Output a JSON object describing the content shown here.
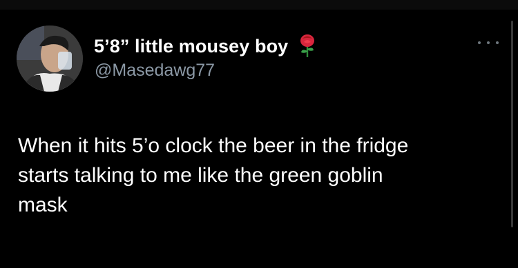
{
  "tweet": {
    "display_name": "5’8” little mousey boy",
    "handle": "@Masedawg77",
    "emoji_icon": "rose-icon",
    "more_icon": "more-icon",
    "text": "When it hits 5’o clock the beer in the fridge\nstarts talking to me like the green goblin\nmask"
  },
  "colors": {
    "background": "#000000",
    "primary_text": "#ffffff",
    "secondary_text": "#8b98a5"
  }
}
